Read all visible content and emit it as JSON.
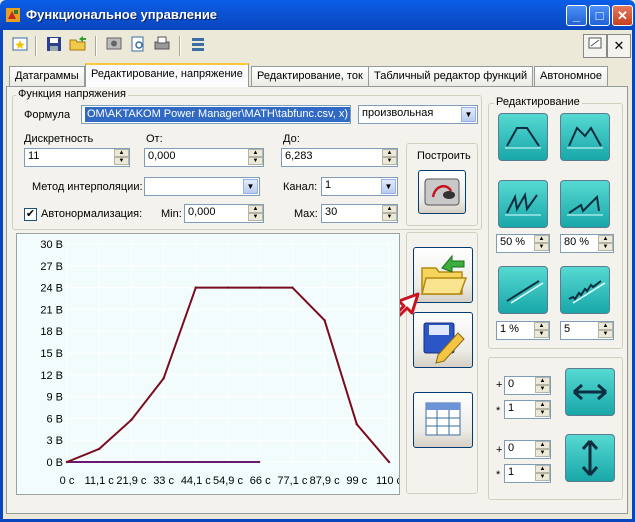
{
  "window": {
    "title": "Функциональное управление",
    "min_label": "_",
    "max_label": "□",
    "close_label": "✕"
  },
  "toolbar": {
    "icons": [
      "new-icon",
      "save-icon",
      "open-icon",
      "preview-icon",
      "page-icon",
      "print-icon",
      "settings-icon",
      "export-icon",
      "close-doc-icon"
    ],
    "close_doc_label": "✕"
  },
  "tabs": [
    {
      "label": "Датаграммы"
    },
    {
      "label": "Редактирование, напряжение",
      "active": true
    },
    {
      "label": "Редактирование, ток"
    },
    {
      "label": "Табличный редактор функций"
    },
    {
      "label": "Автономное"
    }
  ],
  "func_group": {
    "legend": "Функция напряжения",
    "formula_label": "Формула",
    "formula_value": "OM\\AKTAKOM Power Manager\\MATH\\tabfunc.csv, x)",
    "mode_value": "произвольная",
    "discr_label": "Дискретность",
    "discr_value": "11",
    "from_label": "От:",
    "from_value": "0,000",
    "to_label": "До:",
    "to_value": "6,283",
    "build_label": "Построить",
    "interp_label": "Метод интерполяции:",
    "interp_value": "",
    "channel_label": "Канал:",
    "channel_value": "1",
    "autonorm_label": "Автонормализация:",
    "autonorm_checked": true,
    "min_label": "Min:",
    "min_value": "0,000",
    "max_label": "Max:",
    "max_value": "30"
  },
  "edit_group": {
    "legend": "Редактирование",
    "pct1": "50 %",
    "pct2": "80 %",
    "pct3": "1 %",
    "val4": "5",
    "offset1_sign": "+",
    "offset1_value": "0",
    "scale1_sign": "*",
    "scale1_value": "1",
    "offset2_sign": "+",
    "offset2_value": "0",
    "scale2_sign": "*",
    "scale2_value": "1"
  },
  "colors": {
    "curve": "#7a0c1e",
    "baseline": "#6a1a6e",
    "grid": "#ffffff",
    "arrow": "#c8141e",
    "plot_bg": "#f2fcfd"
  },
  "chart_data": {
    "type": "line",
    "yticks": [
      "30 В",
      "27 В",
      "24 В",
      "21 В",
      "18 В",
      "15 В",
      "12 В",
      "9 В",
      "6 В",
      "3 В",
      "0 В"
    ],
    "xticks": [
      "0 с",
      "11,1 с",
      "21,9 с",
      "33 с",
      "44,1 с",
      "54,9 с",
      "66 с",
      "77,1 с",
      "87,9 с",
      "99 с",
      "110 с"
    ],
    "xlim": [
      0,
      110
    ],
    "ylim": [
      0,
      30
    ],
    "series": [
      {
        "x": [
          0,
          11,
          22,
          33,
          44,
          55,
          66,
          77,
          88,
          99,
          110
        ],
        "y": [
          0,
          1.8,
          5.8,
          11.5,
          24,
          24,
          24,
          24,
          19.5,
          5.2,
          0
        ]
      },
      {
        "x": [
          0,
          66
        ],
        "y": [
          0,
          0
        ]
      }
    ]
  }
}
